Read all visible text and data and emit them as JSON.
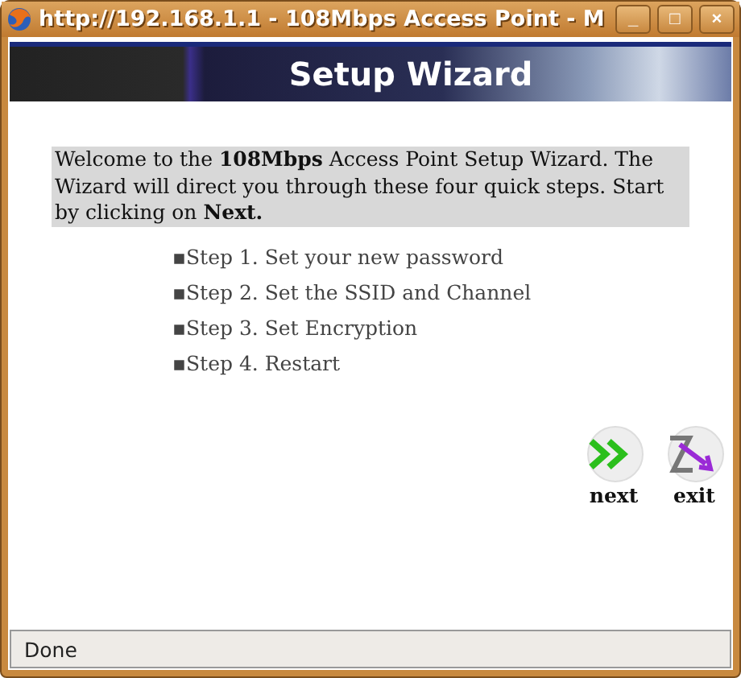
{
  "window": {
    "title": "http://192.168.1.1 - 108Mbps Access Point - M",
    "controls": [
      "_",
      "□",
      "×"
    ]
  },
  "banner": {
    "title": "Setup Wizard"
  },
  "intro": "Welcome to the **108Mbps** Access Point Setup Wizard. The Wizard will direct you through these four quick steps. Start by clicking on **Next.**",
  "steps": [
    {
      "marker": "▪",
      "text": "Step 1. Set your new password"
    },
    {
      "marker": "▪",
      "text": "Step 2. Set the SSID and Channel"
    },
    {
      "marker": "▪",
      "text": "Step 3. Set Encryption"
    },
    {
      "marker": "▪",
      "text": "Step 4. Restart"
    }
  ],
  "buttons": [
    {
      "kind": "next",
      "label": "next"
    },
    {
      "kind": "exit",
      "label": "exit"
    }
  ],
  "status_bar": "Done"
}
